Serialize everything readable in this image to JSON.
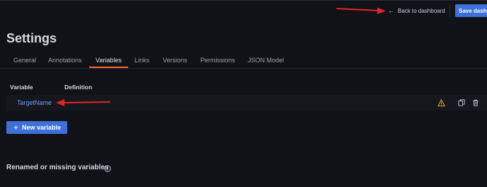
{
  "toolbar": {
    "back_arrow": "←",
    "back_label": "Back to dashboard",
    "save_label": "Save dashboard"
  },
  "page": {
    "title": "Settings"
  },
  "tabs": [
    {
      "label": "General",
      "active": false
    },
    {
      "label": "Annotations",
      "active": false
    },
    {
      "label": "Variables",
      "active": true
    },
    {
      "label": "Links",
      "active": false
    },
    {
      "label": "Versions",
      "active": false
    },
    {
      "label": "Permissions",
      "active": false
    },
    {
      "label": "JSON Model",
      "active": false
    }
  ],
  "table": {
    "headers": [
      "Variable",
      "Definition"
    ],
    "rows": [
      {
        "name": "TargetName",
        "definition": "",
        "icons": [
          "warning-icon",
          "duplicate-icon",
          "trash-icon"
        ]
      }
    ]
  },
  "new_variable": {
    "icon": "+",
    "label": "New variable"
  },
  "renamed_section": {
    "label": "Renamed or missing variables",
    "icon": "info-icon"
  },
  "colors": {
    "background": "#111217",
    "primary": "#3d71d9",
    "link": "#6e9fff",
    "active_tab_underline": "#f56b2b",
    "warning": "#f5a623",
    "annotation_arrow": "#e02424"
  }
}
